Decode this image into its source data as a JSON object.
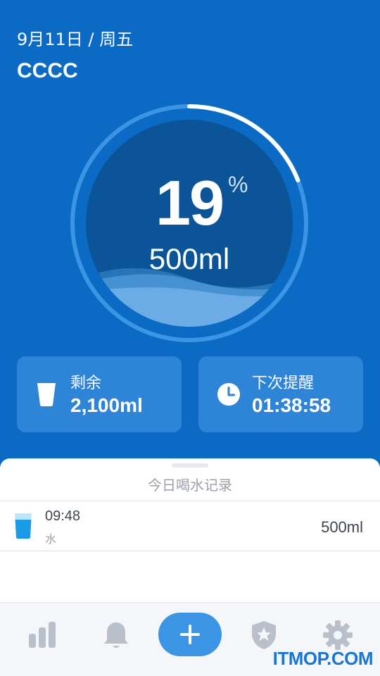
{
  "header": {
    "date": "9月11日 / 周五",
    "user_name": "CCCC"
  },
  "progress": {
    "percent_value": "19",
    "percent_sign": "%",
    "amount": "500ml",
    "fraction": 0.19
  },
  "cards": {
    "remaining": {
      "label": "剩余",
      "value": "2,100ml",
      "icon": "cup-icon"
    },
    "next_reminder": {
      "label": "下次提醒",
      "value": "01:38:58",
      "icon": "clock-icon"
    }
  },
  "records": {
    "title": "今日喝水记录",
    "items": [
      {
        "time": "09:48",
        "type": "水",
        "amount": "500ml"
      }
    ]
  },
  "tabbar": {
    "items": [
      {
        "name": "stats",
        "icon": "bar-chart-icon"
      },
      {
        "name": "reminders",
        "icon": "bell-icon"
      },
      {
        "name": "add",
        "icon": "plus-icon"
      },
      {
        "name": "achievements",
        "icon": "shield-star-icon"
      },
      {
        "name": "settings",
        "icon": "gear-icon"
      }
    ]
  },
  "watermark": "ITMOP.COM",
  "colors": {
    "primary": "#0a6ac4",
    "accent": "#3b95e4",
    "card": "#2e84d6",
    "tab_icon": "#b9c0ca"
  }
}
